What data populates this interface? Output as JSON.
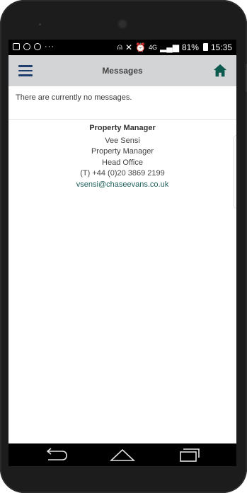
{
  "status_bar": {
    "overflow_dots": "···",
    "network": "4G",
    "battery_percent": "81%",
    "time": "15:35",
    "icons": [
      "gallery-icon",
      "whatsapp-icon",
      "sync-icon",
      "nfc-icon",
      "mute-icon",
      "alarm-icon",
      "signal-icon",
      "battery-icon"
    ]
  },
  "header": {
    "title": "Messages",
    "menu_icon": "hamburger-menu-icon",
    "home_icon": "home-icon",
    "accent_color": "#1e3f6e",
    "home_color": "#0d5a4f",
    "background": "#d3d4d6"
  },
  "messages": {
    "empty_text": "There are currently no messages."
  },
  "contact": {
    "heading": "Property Manager",
    "name": "Vee Sensi",
    "role": "Property Manager",
    "office": "Head Office",
    "phone": "(T) +44 (0)20 3869 2199",
    "email": "vsensi@chaseevans.co.uk",
    "email_color": "#1f5f5b"
  },
  "nav_bar": {
    "buttons": [
      "back-icon",
      "home-nav-icon",
      "recent-apps-icon"
    ]
  }
}
